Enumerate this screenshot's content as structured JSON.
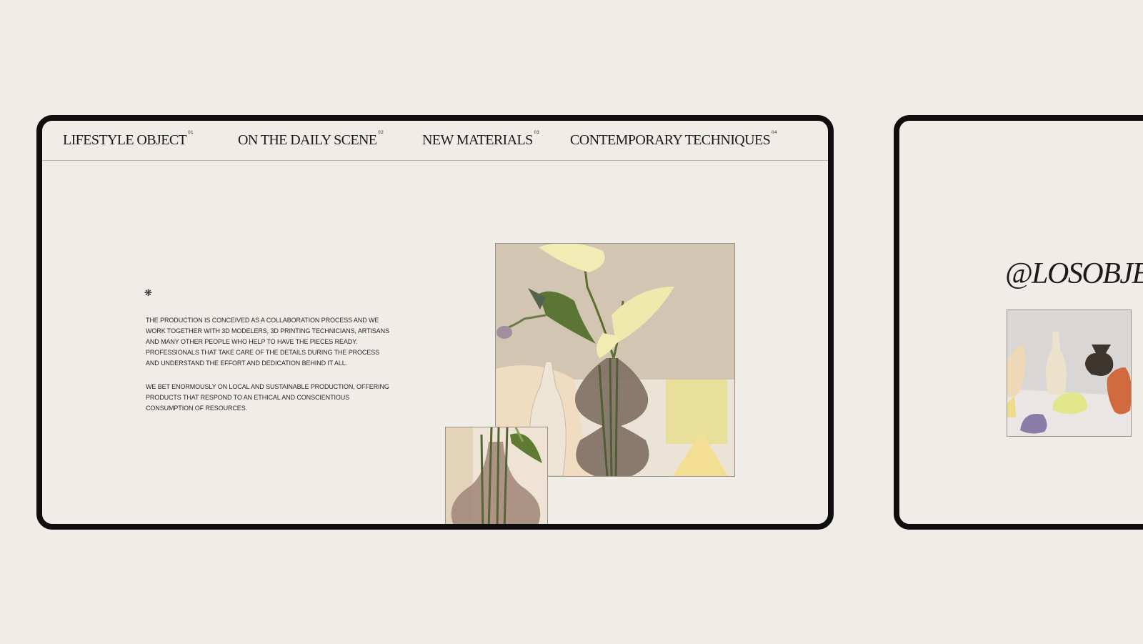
{
  "nav": {
    "items": [
      {
        "label": "LIFESTYLE OBJECT",
        "num": "01"
      },
      {
        "label": "ON THE DAILY SCENE",
        "num": "02"
      },
      {
        "label": "NEW MATERIALS",
        "num": "03"
      },
      {
        "label": "CONTEMPORARY TECHNIQUES",
        "num": "04"
      }
    ]
  },
  "content": {
    "asterisk": "❋",
    "paragraph_1": "THE PRODUCTION IS CONCEIVED AS A COLLABORATION PROCESS AND WE WORK TOGETHER WITH 3D MODELERS, 3D PRINTING TECHNICIANS, ARTISANS AND MANY OTHER PEOPLE WHO HELP TO HAVE THE PIECES READY. PROFESSIONALS THAT TAKE CARE OF THE DETAILS DURING THE PROCESS AND UNDERSTAND THE EFFORT AND DEDICATION BEHIND IT ALL.",
    "paragraph_2": "WE BET ENORMOUSLY ON LOCAL AND SUSTAINABLE PRODUCTION, OFFERING PRODUCTS THAT RESPOND TO AN ETHICAL AND CONSCIENTIOUS CONSUMPTION OF RESOURCES."
  },
  "side_panel": {
    "handle": "@LOSOBJETOS"
  },
  "colors": {
    "background": "#f0ece8",
    "frame_border": "#0e0e0e",
    "text": "#1a1a1a"
  }
}
